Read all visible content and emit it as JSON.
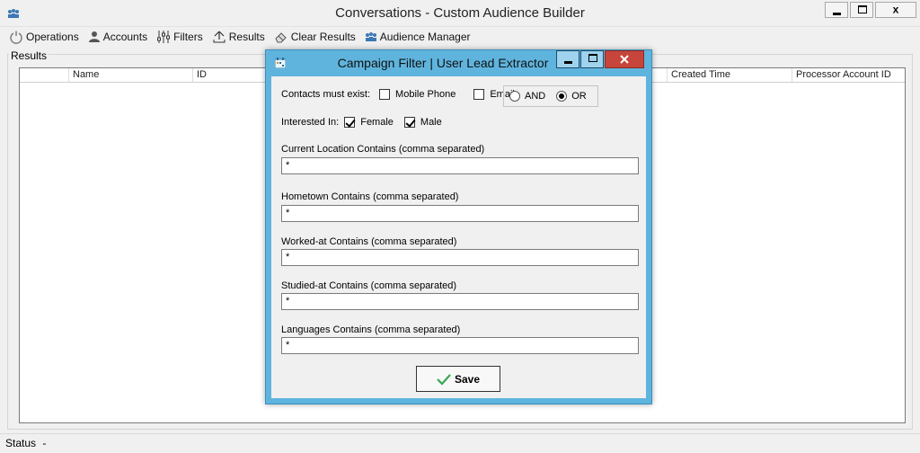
{
  "window": {
    "title": "Conversations - Custom Audience Builder",
    "min_label": "",
    "max_label": "",
    "close_label": "x"
  },
  "toolbar": {
    "items": [
      {
        "label": "Operations",
        "icon": "power-icon"
      },
      {
        "label": "Accounts",
        "icon": "user-icon"
      },
      {
        "label": "Filters",
        "icon": "sliders-icon"
      },
      {
        "label": "Results",
        "icon": "upload-icon"
      },
      {
        "label": "Clear Results",
        "icon": "eraser-icon"
      },
      {
        "label": "Audience Manager",
        "icon": "people-icon"
      }
    ]
  },
  "results": {
    "group_label": "Results",
    "columns": [
      "Name",
      "ID",
      "Created Time",
      "Processor Account ID"
    ]
  },
  "status": {
    "label": "Status",
    "value": "-"
  },
  "dialog": {
    "title": "Campaign Filter | User Lead Extractor",
    "contacts_label": "Contacts must exist:",
    "mobile_phone_label": "Mobile Phone",
    "mobile_phone_checked": false,
    "email_label": "Email",
    "email_checked": false,
    "and_label": "AND",
    "or_label": "OR",
    "selected_operator": "OR",
    "interested_label": "Interested In:",
    "female_label": "Female",
    "female_checked": true,
    "male_label": "Male",
    "male_checked": true,
    "fields": [
      {
        "label": "Current Location Contains (comma separated)",
        "value": "*"
      },
      {
        "label": "Hometown Contains (comma separated)",
        "value": "*"
      },
      {
        "label": "Worked-at Contains (comma separated)",
        "value": "*"
      },
      {
        "label": "Studied-at Contains (comma separated)",
        "value": "*"
      },
      {
        "label": "Languages  Contains (comma separated)",
        "value": "*"
      }
    ],
    "save_label": "Save"
  },
  "colors": {
    "dialog_frame": "#5fb4de",
    "close_button": "#c7453a",
    "save_check": "#3aa655"
  }
}
